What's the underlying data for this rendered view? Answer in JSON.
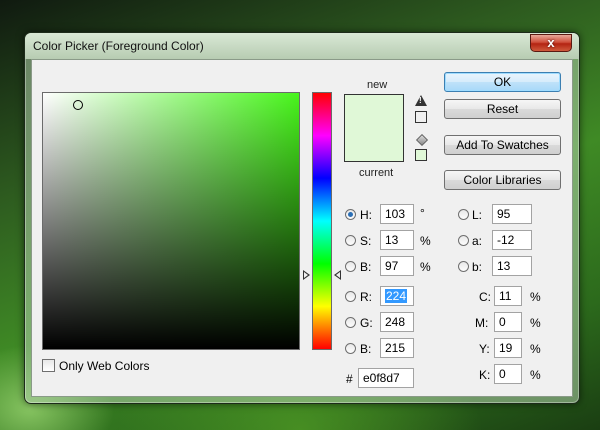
{
  "window": {
    "title": "Color Picker (Foreground Color)",
    "close_label": "x"
  },
  "colors": {
    "new_color": "#e0f8d7",
    "current_color": "#e0f8d7",
    "hue_color": "#48f51c",
    "ok_border": "#3c7fb1"
  },
  "swatch": {
    "new_label": "new",
    "current_label": "current"
  },
  "buttons": {
    "ok": "OK",
    "reset": "Reset",
    "add_to_swatches": "Add To Swatches",
    "color_libraries": "Color Libraries"
  },
  "hsb": {
    "h": {
      "label": "H:",
      "value": "103",
      "unit": "°",
      "selected": true
    },
    "s": {
      "label": "S:",
      "value": "13",
      "unit": "%",
      "selected": false
    },
    "b": {
      "label": "B:",
      "value": "97",
      "unit": "%",
      "selected": false
    }
  },
  "lab": {
    "l": {
      "label": "L:",
      "value": "95"
    },
    "a": {
      "label": "a:",
      "value": "-12"
    },
    "b": {
      "label": "b:",
      "value": "13"
    }
  },
  "rgb": {
    "r": {
      "label": "R:",
      "value": "224"
    },
    "g": {
      "label": "G:",
      "value": "248"
    },
    "b": {
      "label": "B:",
      "value": "215"
    }
  },
  "cmyk": {
    "c": {
      "label": "C:",
      "value": "11",
      "unit": "%"
    },
    "m": {
      "label": "M:",
      "value": "0",
      "unit": "%"
    },
    "y": {
      "label": "Y:",
      "value": "19",
      "unit": "%"
    },
    "k": {
      "label": "K:",
      "value": "0",
      "unit": "%"
    }
  },
  "hex": {
    "label": "#",
    "value": "e0f8d7"
  },
  "web_colors": {
    "label": "Only Web Colors",
    "checked": false
  },
  "icons": {
    "gamut_warning": "warning-triangle-icon",
    "web_safe": "cube-icon"
  }
}
